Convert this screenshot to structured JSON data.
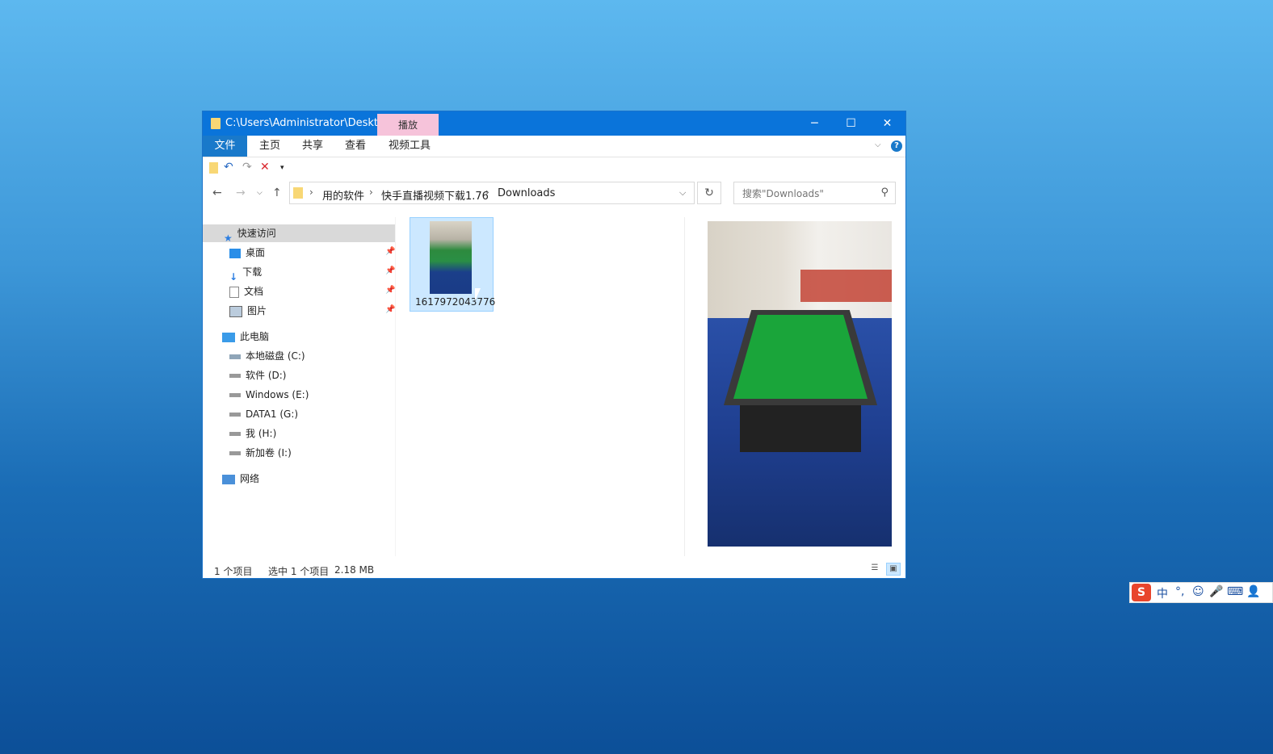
{
  "window": {
    "title": "C:\\Users\\Administrator\\Deskto...",
    "context_tab": "播放",
    "controls": {
      "minimize": "─",
      "maximize": "☐",
      "close": "✕"
    }
  },
  "ribbon": {
    "tabs": [
      "文件",
      "主页",
      "共享",
      "查看",
      "视频工具"
    ],
    "help": "?"
  },
  "address": {
    "breadcrumbs": [
      "用的软件",
      "快手直播视频下载1.76",
      "Downloads"
    ],
    "separator": "›"
  },
  "search": {
    "placeholder": "搜索\"Downloads\""
  },
  "nav": {
    "quick_access": "快速访问",
    "quick_items": [
      "桌面",
      "下载",
      "文档",
      "图片"
    ],
    "this_pc": "此电脑",
    "drives": [
      "本地磁盘 (C:)",
      "软件 (D:)",
      "Windows (E:)",
      "DATA1 (G:)",
      "我 (H:)",
      "新加卷 (I:)"
    ],
    "network": "网络"
  },
  "files": [
    {
      "name": "16179720437​76",
      "selected": true
    }
  ],
  "status": {
    "count": "1 个项目",
    "selection": "选中 1 个项目",
    "size": "2.18 MB"
  },
  "ime": {
    "logo": "S",
    "mode": "中",
    "punct": "°,",
    "emoji": "☺",
    "mic": "🎤",
    "keyboard": "⌨",
    "user": "👤"
  },
  "colors": {
    "accent": "#0a74da",
    "context_tab": "#f6c3da",
    "selection": "#cce8ff"
  }
}
